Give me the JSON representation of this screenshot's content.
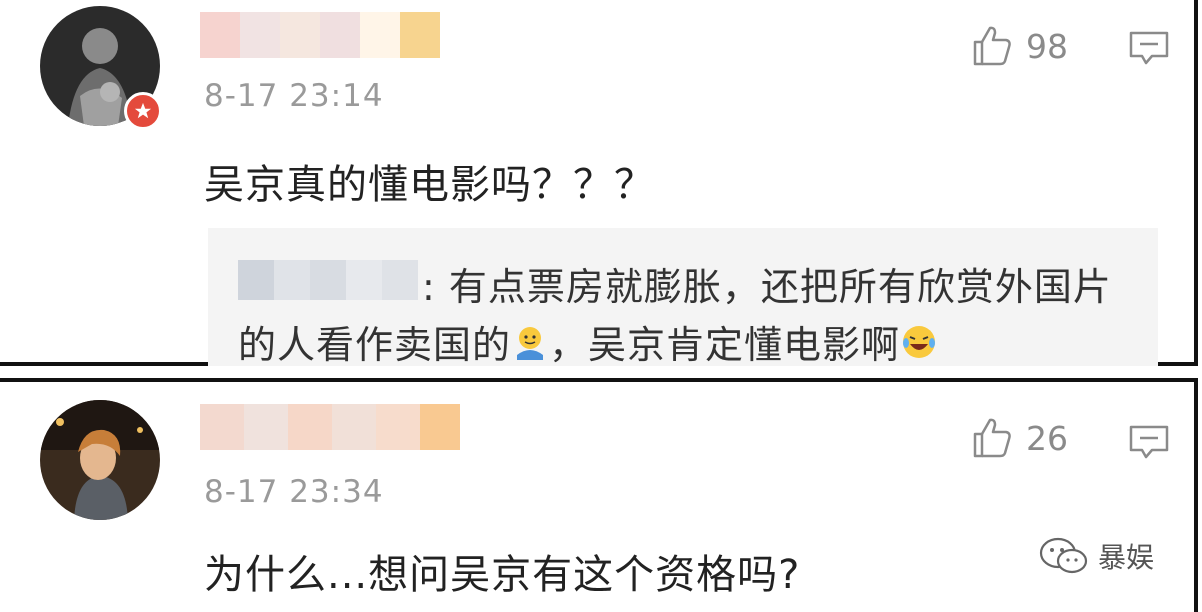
{
  "comments": [
    {
      "timestamp": "8-17 23:14",
      "text": "吴京真的懂电影吗？？？",
      "likes": "98",
      "avatar_badge": "red-star-badge",
      "reply": {
        "line1": ": 有点票房就膨胀，还把所有欣赏外国片",
        "line2_before_emoji": "的人看作卖国的",
        "line2_middle": "，吴京肯定懂电影啊"
      }
    },
    {
      "timestamp": "8-17 23:34",
      "text": "为什么...想问吴京有这个资格吗?",
      "likes": "26"
    }
  ],
  "watermark": {
    "label": "暴娱"
  },
  "colors": {
    "badge_red": "#e44a3c",
    "timestamp_gray": "#9a9a9a",
    "reply_background": "#f4f4f4"
  }
}
